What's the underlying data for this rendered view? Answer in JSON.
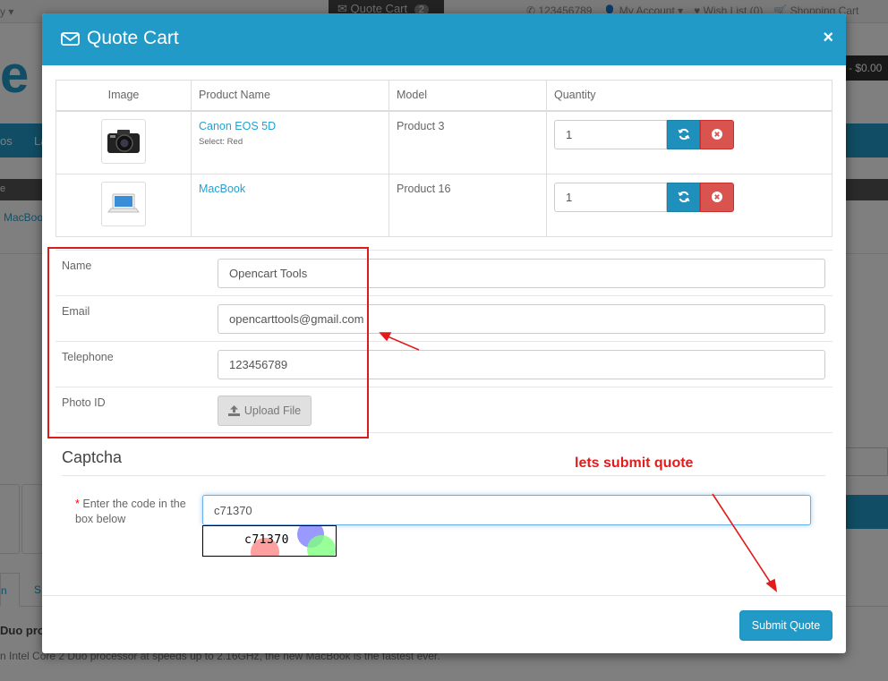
{
  "background": {
    "currency_label": "y",
    "quote_cart_button": "Quote Cart",
    "quote_cart_count": "2",
    "phone": "123456789",
    "my_account": "My Account",
    "wish_list": "Wish List (0)",
    "shopping_cart": "Shopping Cart",
    "logo_fragment": "e",
    "cart_total": "- $0.00",
    "nav_items": [
      "os",
      "La"
    ],
    "breadcrumb_fragment": "e",
    "product_crumb": "MacBoo",
    "tab_first": "n",
    "tab_second": "S",
    "heading_fragment": "Duo proc",
    "description_fragment": "n Intel Core 2 Duo processor at speeds up to 2.16GHz, the new MacBook is the fastest ever."
  },
  "modal": {
    "title": "Quote Cart",
    "title_icon": "envelope-icon",
    "close": "×",
    "table": {
      "headers": [
        "Image",
        "Product Name",
        "Model",
        "Quantity"
      ],
      "rows": [
        {
          "image_icon": "camera-icon",
          "name": "Canon EOS 5D",
          "option": "Select: Red",
          "model": "Product 3",
          "quantity": "1"
        },
        {
          "image_icon": "laptop-icon",
          "name": "MacBook",
          "option": "",
          "model": "Product 16",
          "quantity": "1"
        }
      ]
    },
    "form": {
      "name_label": "Name",
      "name_value": "Opencart Tools",
      "email_label": "Email",
      "email_value": "opencarttools@gmail.com",
      "telephone_label": "Telephone",
      "telephone_value": "123456789",
      "photo_label": "Photo ID",
      "upload_label": "Upload File"
    },
    "captcha": {
      "legend": "Captcha",
      "required_mark": "*",
      "label": "Enter the code in the box below",
      "value": "c71370",
      "image_code": "c71370"
    },
    "submit": "Submit Quote"
  },
  "annotation": {
    "text": "lets submit quote",
    "color": "#e31b1b"
  },
  "colors": {
    "primary": "#229ac8",
    "danger": "#d9534f",
    "link": "#23a1d1"
  }
}
